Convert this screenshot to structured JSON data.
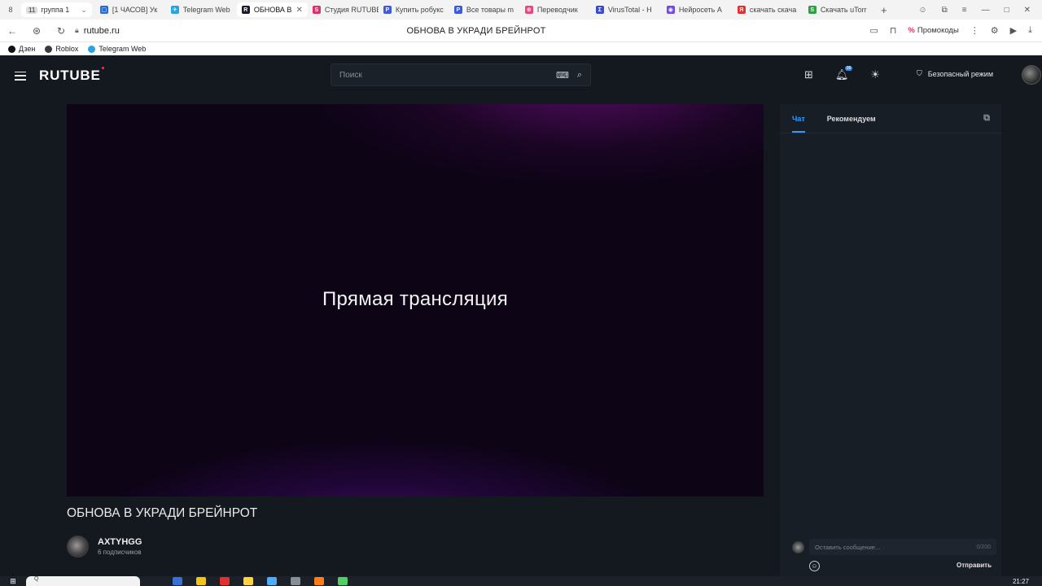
{
  "browser": {
    "tab_count": "8",
    "group": {
      "number": "11",
      "label": "группа 1"
    },
    "tabs": [
      {
        "label": "[1 ЧАСОВ] Ук",
        "color": "#2a6bd6",
        "glyph": "▢"
      },
      {
        "label": "Telegram Web",
        "color": "#2aa3e0",
        "glyph": "✈"
      },
      {
        "label": "ОБНОВА В",
        "color": "#1a1a2e",
        "glyph": "R"
      },
      {
        "label": "Студия RUTUBE",
        "color": "#d6336c",
        "glyph": "S"
      },
      {
        "label": "Купить робукс",
        "color": "#3b5bdb",
        "glyph": "P"
      },
      {
        "label": "Все товары m",
        "color": "#3b5bdb",
        "glyph": "P"
      },
      {
        "label": "Переводчик",
        "color": "#e64980",
        "glyph": "⊕"
      },
      {
        "label": "VirusTotal - H",
        "color": "#3b4cca",
        "glyph": "Σ"
      },
      {
        "label": "Нейросеть A",
        "color": "#7048e8",
        "glyph": "◉"
      },
      {
        "label": "скачать скача",
        "color": "#e03131",
        "glyph": "Я"
      },
      {
        "label": "Скачать uTorr",
        "color": "#2f9e44",
        "glyph": "S"
      }
    ],
    "active_tab_index": 2,
    "url": "rutube.ru",
    "page_title": "ОБНОВА В УКРАДИ БРЕЙНРОТ",
    "promo_label": "Промокоды",
    "bookmarks": [
      {
        "label": "Дзен",
        "color": "#111111"
      },
      {
        "label": "Roblox",
        "color": "#3b3b3b"
      },
      {
        "label": "Telegram Web",
        "color": "#2aa3e0"
      }
    ]
  },
  "header": {
    "logo": "RUTUBE",
    "search_placeholder": "Поиск",
    "notifications_badge": "99",
    "safe_mode_label": "Безопасный режим"
  },
  "player": {
    "status_text": "Прямая трансляция"
  },
  "video": {
    "title": "ОБНОВА В УКРАДИ БРЕЙНРОТ",
    "channel_name": "AXTYHGG",
    "subscribers": "6 подписчиков"
  },
  "chat": {
    "tabs": [
      "Чат",
      "Рекомендуем"
    ],
    "input_placeholder": "Оставить сообщение...",
    "counter": "0/200",
    "send_label": "Отправить"
  },
  "taskbar": {
    "search_placeholder": "Q",
    "clock": "21:27"
  },
  "colors": {
    "accent": "#2e9bff",
    "background": "#14191f",
    "logo_dot": "#ff2e4d"
  }
}
